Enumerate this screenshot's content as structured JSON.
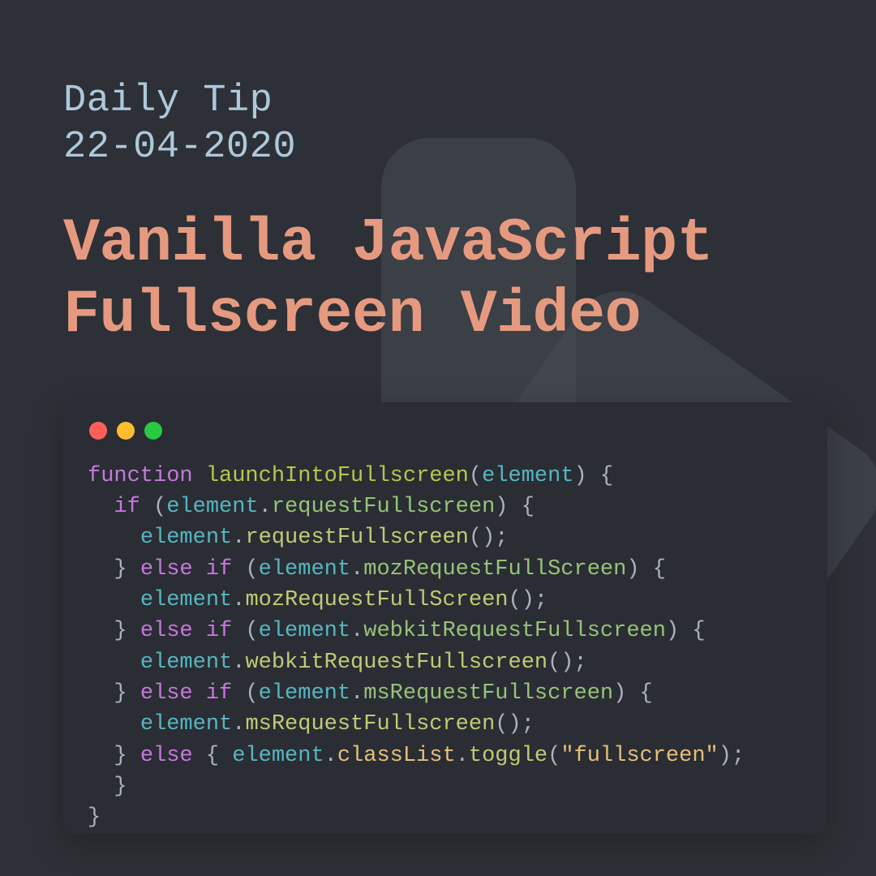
{
  "header": {
    "subtitle_line1": "Daily Tip",
    "subtitle_line2": "22-04-2020",
    "title_line1": "Vanilla JavaScript",
    "title_line2": "Fullscreen Video"
  },
  "code": {
    "tokens": [
      [
        [
          "kw",
          "function"
        ],
        [
          "punc",
          " "
        ],
        [
          "fn",
          "launchIntoFullscreen"
        ],
        [
          "punc",
          "("
        ],
        [
          "id",
          "element"
        ],
        [
          "punc",
          ") {"
        ]
      ],
      [
        [
          "punc",
          "  "
        ],
        [
          "kw",
          "if"
        ],
        [
          "punc",
          " ("
        ],
        [
          "id",
          "element"
        ],
        [
          "punc",
          "."
        ],
        [
          "prop",
          "requestFullscreen"
        ],
        [
          "punc",
          ") {"
        ]
      ],
      [
        [
          "punc",
          "    "
        ],
        [
          "id",
          "element"
        ],
        [
          "punc",
          "."
        ],
        [
          "call",
          "requestFullscreen"
        ],
        [
          "punc",
          "();"
        ]
      ],
      [
        [
          "punc",
          "  } "
        ],
        [
          "kw",
          "else if"
        ],
        [
          "punc",
          " ("
        ],
        [
          "id",
          "element"
        ],
        [
          "punc",
          "."
        ],
        [
          "prop",
          "mozRequestFullScreen"
        ],
        [
          "punc",
          ") {"
        ]
      ],
      [
        [
          "punc",
          "    "
        ],
        [
          "id",
          "element"
        ],
        [
          "punc",
          "."
        ],
        [
          "call",
          "mozRequestFullScreen"
        ],
        [
          "punc",
          "();"
        ]
      ],
      [
        [
          "punc",
          "  } "
        ],
        [
          "kw",
          "else if"
        ],
        [
          "punc",
          " ("
        ],
        [
          "id",
          "element"
        ],
        [
          "punc",
          "."
        ],
        [
          "prop",
          "webkitRequestFullscreen"
        ],
        [
          "punc",
          ") {"
        ]
      ],
      [
        [
          "punc",
          "    "
        ],
        [
          "id",
          "element"
        ],
        [
          "punc",
          "."
        ],
        [
          "call",
          "webkitRequestFullscreen"
        ],
        [
          "punc",
          "();"
        ]
      ],
      [
        [
          "punc",
          "  } "
        ],
        [
          "kw",
          "else if"
        ],
        [
          "punc",
          " ("
        ],
        [
          "id",
          "element"
        ],
        [
          "punc",
          "."
        ],
        [
          "prop",
          "msRequestFullscreen"
        ],
        [
          "punc",
          ") {"
        ]
      ],
      [
        [
          "punc",
          "    "
        ],
        [
          "id",
          "element"
        ],
        [
          "punc",
          "."
        ],
        [
          "call",
          "msRequestFullscreen"
        ],
        [
          "punc",
          "();"
        ]
      ],
      [
        [
          "punc",
          "  } "
        ],
        [
          "kw",
          "else"
        ],
        [
          "punc",
          " { "
        ],
        [
          "id",
          "element"
        ],
        [
          "punc",
          "."
        ],
        [
          "prop2",
          "classList"
        ],
        [
          "punc",
          "."
        ],
        [
          "call",
          "toggle"
        ],
        [
          "punc",
          "("
        ],
        [
          "str",
          "\"fullscreen\""
        ],
        [
          "punc",
          ");"
        ]
      ],
      [
        [
          "punc",
          "  }"
        ]
      ],
      [
        [
          "punc",
          "}"
        ]
      ]
    ]
  },
  "colors": {
    "background": "#2d3036",
    "accent": "#e59a80",
    "subtitle": "#aec8db",
    "code_bg": "#2a2d33"
  }
}
